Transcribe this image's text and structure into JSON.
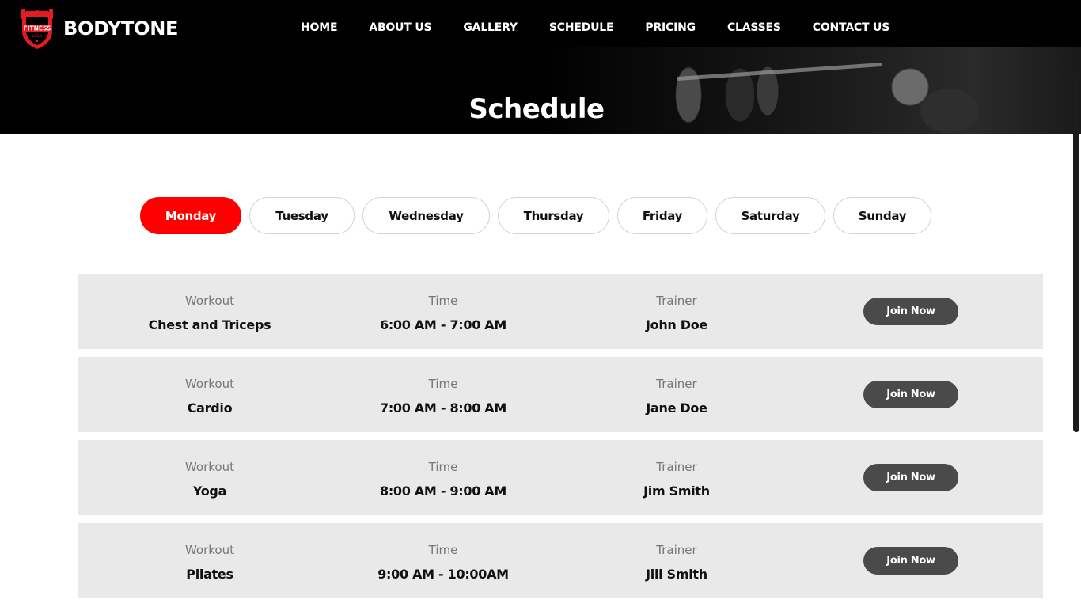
{
  "brand": {
    "name": "BODYTONE",
    "logo_text": "FITNESS",
    "logo_subtext": "LOGO",
    "logo_color": "#e31b23"
  },
  "nav": {
    "items": [
      "HOME",
      "ABOUT US",
      "GALLERY",
      "SCHEDULE",
      "PRICING",
      "CLASSES",
      "CONTACT US"
    ]
  },
  "hero": {
    "title": "Schedule"
  },
  "tabs": {
    "active": "Monday",
    "accent_color": "#ff0000",
    "items": [
      "Monday",
      "Tuesday",
      "Wednesday",
      "Thursday",
      "Friday",
      "Saturday",
      "Sunday"
    ]
  },
  "schedule": {
    "labels": {
      "workout": "Workout",
      "time": "Time",
      "trainer": "Trainer",
      "join": "Join Now"
    },
    "rows": [
      {
        "workout": "Chest and Triceps",
        "time": "6:00 AM - 7:00 AM",
        "trainer": "John Doe"
      },
      {
        "workout": "Cardio",
        "time": "7:00 AM - 8:00 AM",
        "trainer": "Jane Doe"
      },
      {
        "workout": "Yoga",
        "time": "8:00 AM - 9:00 AM",
        "trainer": "Jim Smith"
      },
      {
        "workout": "Pilates",
        "time": "9:00 AM - 10:00AM",
        "trainer": "Jill Smith"
      }
    ]
  }
}
